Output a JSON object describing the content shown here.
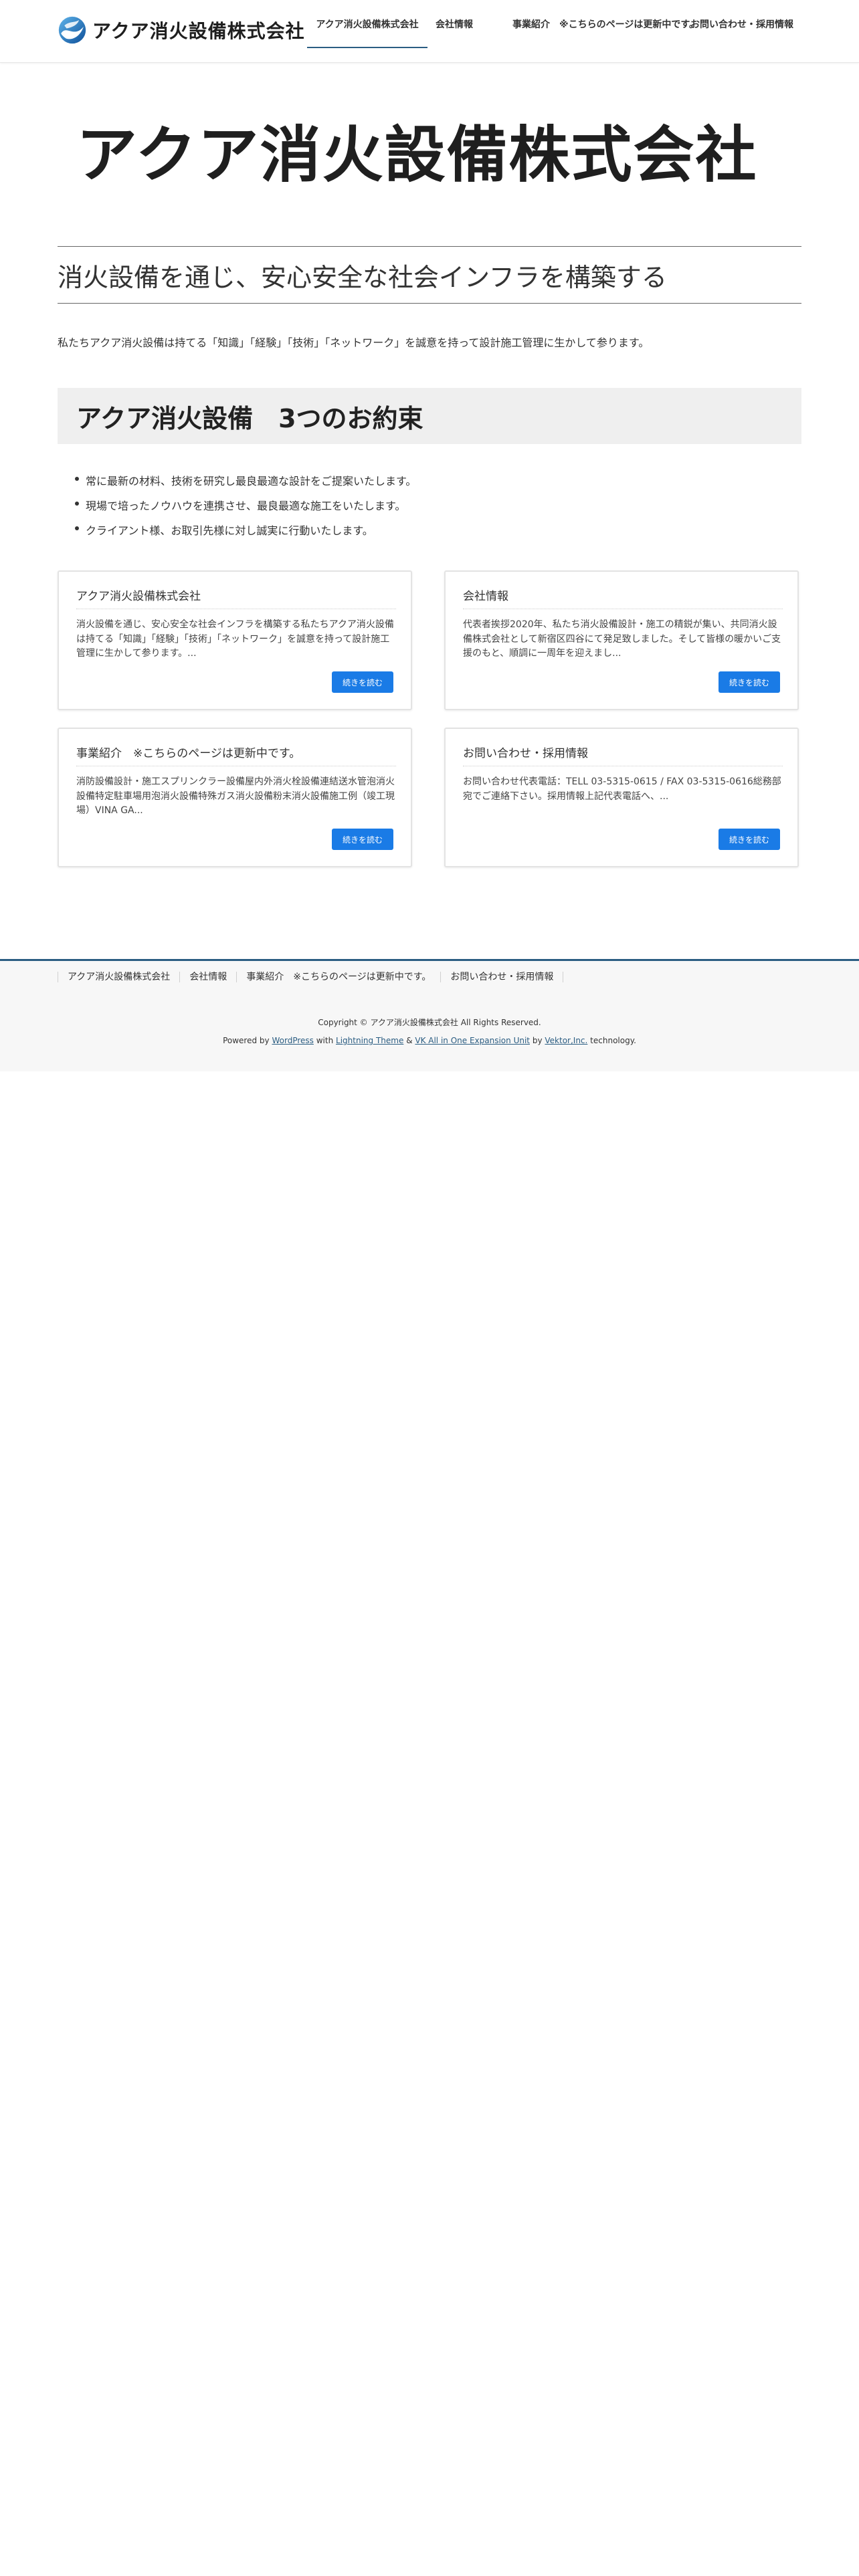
{
  "header": {
    "logo_text": "アクア消火設備株式会社",
    "nav": [
      {
        "label": "アクア消火設備株式会社",
        "current": true
      },
      {
        "label": "会社情報",
        "current": false
      },
      {
        "label": "事業紹介　※こちらのページは更新中です。",
        "current": false
      },
      {
        "label": "お問い合わせ・採用情報",
        "current": false
      }
    ]
  },
  "hero": {
    "logo_text": "アクア消火設備株式会社"
  },
  "main": {
    "headline": "消火設備を通じ、安心安全な社会インフラを構築する",
    "intro": "私たちアクア消火設備は持てる「知識」「経験」「技術」「ネットワーク」を誠意を持って設計施工管理に生かして参ります。",
    "promise_title": "アクア消火設備　3つのお約束",
    "promises": [
      "常に最新の材料、技術を研究し最良最適な設計をご提案いたします。",
      "現場で培ったノウハウを連携させ、最良最適な施工をいたします。",
      "クライアント様、お取引先様に対し誠実に行動いたします。"
    ],
    "cards": [
      {
        "title": "アクア消火設備株式会社",
        "text": "消火設備を通じ、安心安全な社会インフラを構築する私たちアクア消火設備は持てる「知識」「経験」「技術」「ネットワーク」を誠意を持って設計施工管理に生かして参ります。...",
        "button": "続きを読む"
      },
      {
        "title": "会社情報",
        "text": "代表者挨拶2020年、私たち消火設備設計・施工の精鋭が集い、共同消火設備株式会社として新宿区四谷にて発足致しました。そして皆様の暖かいご支援のもと、順調に一周年を迎えまし...",
        "button": "続きを読む"
      },
      {
        "title": "事業紹介　※こちらのページは更新中です。",
        "text": "消防設備設計・施工スプリンクラー設備屋内外消火栓設備連結送水管泡消火設備特定駐車場用泡消火設備特殊ガス消火設備粉末消火設備施工例（竣工現場）VINA GA...",
        "button": "続きを読む"
      },
      {
        "title": "お問い合わせ・採用情報",
        "text": "お問い合わせ代表電話：TELL 03-5315-0615 / FAX 03-5315-0616総務部宛でご連絡下さい。採用情報上記代表電話へ、...",
        "button": "続きを読む"
      }
    ]
  },
  "footer": {
    "nav": [
      "アクア消火設備株式会社",
      "会社情報",
      "事業紹介　※こちらのページは更新中です。",
      "お問い合わせ・採用情報"
    ],
    "copyright": "Copyright © アクア消火設備株式会社 All Rights Reserved.",
    "powered_prefix": "Powered by",
    "powered_wp": "WordPress",
    "powered_with": "with",
    "powered_theme": "Lightning Theme",
    "powered_amp": "&",
    "powered_unit": "VK All in One Expansion Unit",
    "powered_by": "by",
    "powered_vektor": "Vektor,Inc.",
    "powered_suffix": "technology."
  },
  "colors": {
    "accent": "#2b5d82",
    "button": "#1a7be6",
    "promise_bg": "#efefef",
    "footer_bg": "#f7f7f7"
  }
}
